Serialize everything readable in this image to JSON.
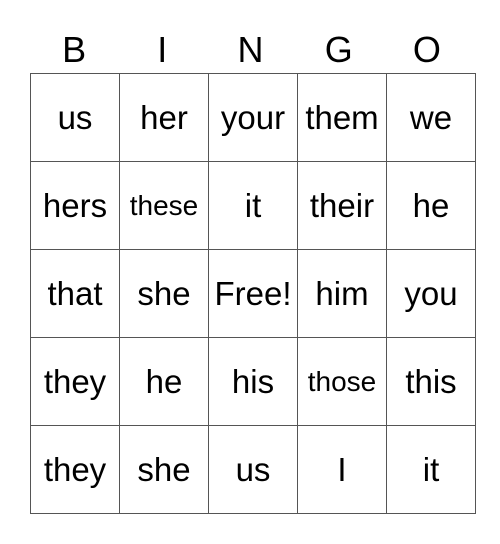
{
  "header": [
    "B",
    "I",
    "N",
    "G",
    "O"
  ],
  "rows": [
    [
      "us",
      "her",
      "your",
      "them",
      "we"
    ],
    [
      "hers",
      "these",
      "it",
      "their",
      "he"
    ],
    [
      "that",
      "she",
      "Free!",
      "him",
      "you"
    ],
    [
      "they",
      "he",
      "his",
      "those",
      "this"
    ],
    [
      "they",
      "she",
      "us",
      "I",
      "it"
    ]
  ]
}
